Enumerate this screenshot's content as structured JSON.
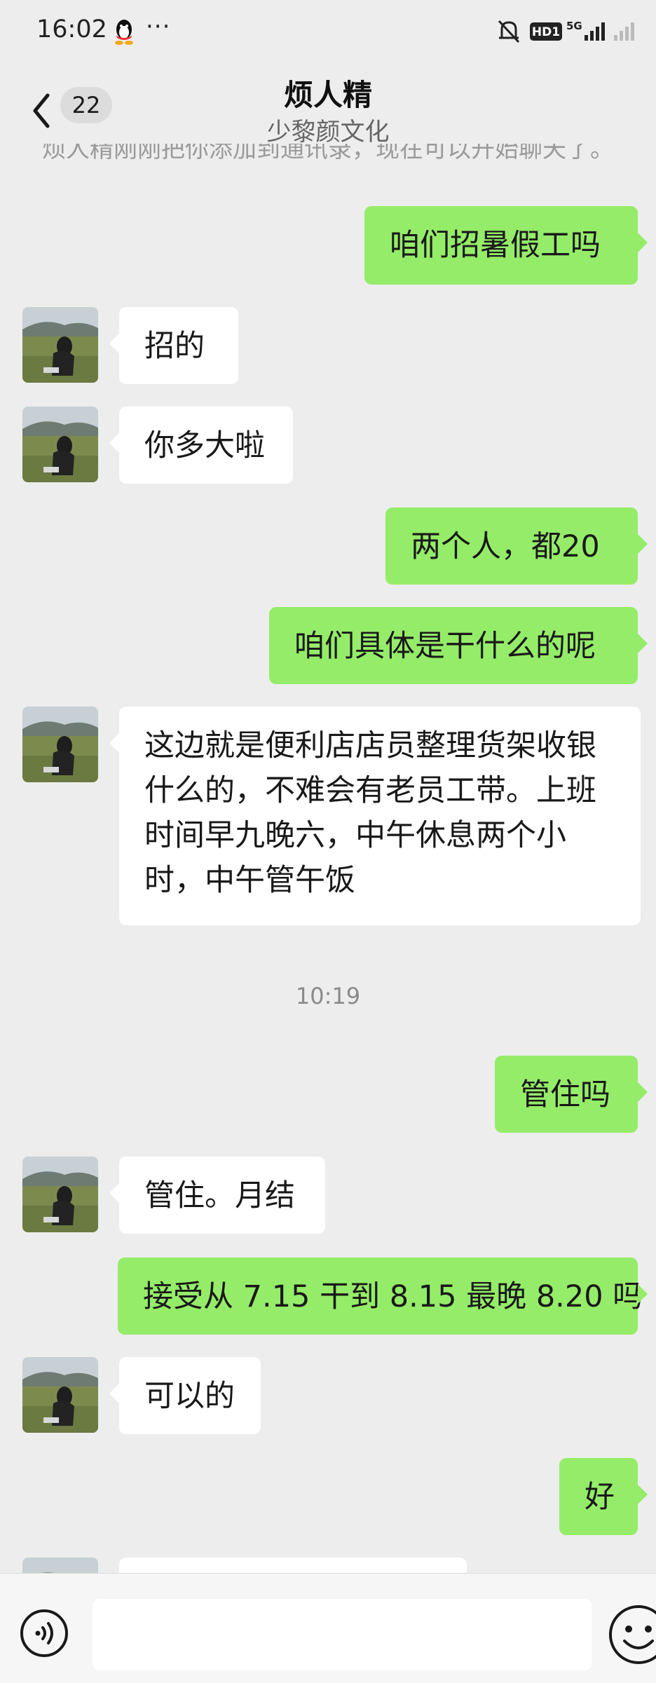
{
  "status_bar": {
    "time": "16:02",
    "more": "···",
    "hd_label": "HD1",
    "net_label": "5G"
  },
  "header": {
    "unread_count": "22",
    "title": "烦人精",
    "subtitle": "少黎颜文化"
  },
  "system_message": "烦人精刚刚把你添加到通讯录，现在可以开始聊天了。",
  "messages": [
    {
      "side": "out",
      "text": "咱们招暑假工吗"
    },
    {
      "side": "in",
      "text": "招的"
    },
    {
      "side": "in",
      "text": "你多大啦"
    },
    {
      "side": "out",
      "text": "两个人，都20"
    },
    {
      "side": "out",
      "text": "咱们具体是干什么的呢"
    },
    {
      "side": "in",
      "lines": [
        "这边就是便利店店员整理货架收银",
        "什么的，不难会有老员工带。上班",
        "时间早九晚六，中午休息两个小",
        "时，中午管午饭"
      ]
    },
    {
      "side": "time",
      "text": "10:19"
    },
    {
      "side": "out",
      "text": "管住吗"
    },
    {
      "side": "in",
      "text": "管住。月结"
    },
    {
      "side": "out",
      "text": "接受从 7.15 干到 8.15 最晚 8.20 吗"
    },
    {
      "side": "in",
      "text": "可以的"
    },
    {
      "side": "out",
      "text": "好"
    }
  ],
  "input": {
    "placeholder": ""
  },
  "colors": {
    "background": "#ededed",
    "outgoing_bubble": "#95ec69",
    "incoming_bubble": "#ffffff"
  },
  "icons": {
    "back": "chevron-left-icon",
    "voice": "voice-icon",
    "emoji": "emoji-icon",
    "qq": "qq-penguin-icon"
  }
}
